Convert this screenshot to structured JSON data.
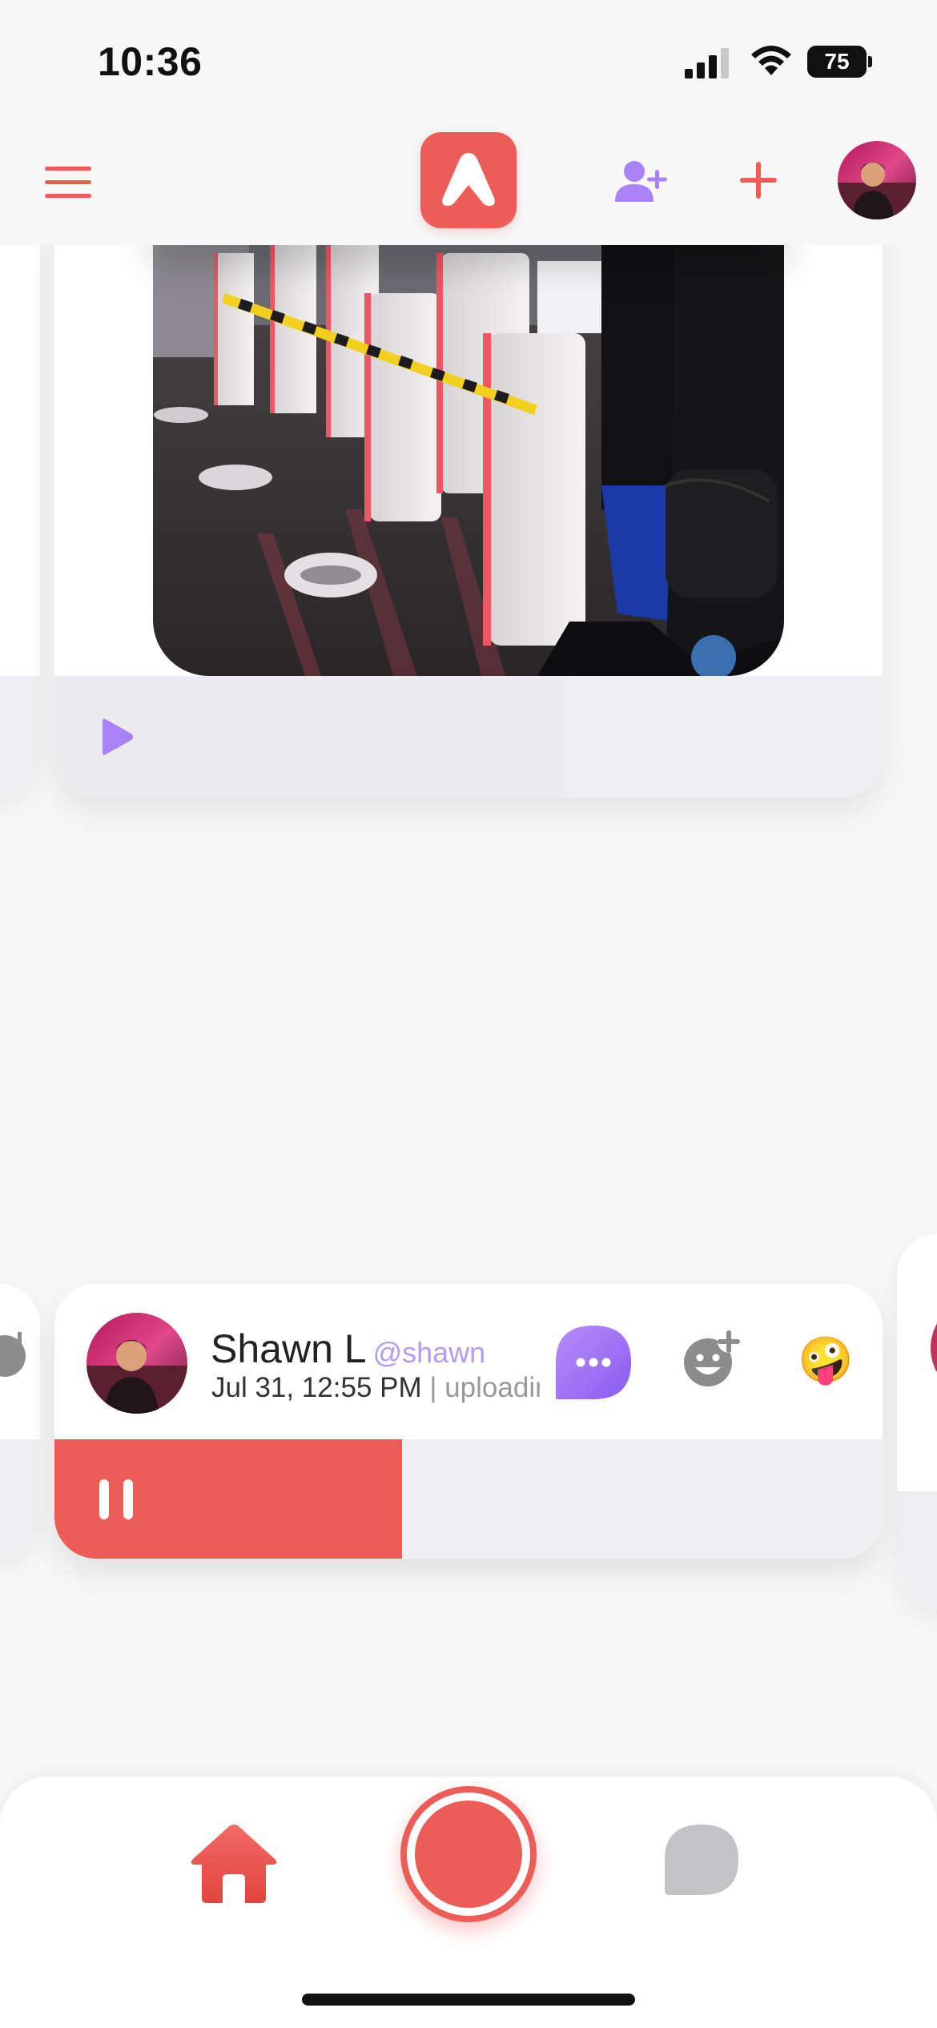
{
  "status_bar": {
    "time": "10:36",
    "battery_level": "75",
    "icons": [
      "signal-icon",
      "wifi-icon",
      "battery-icon"
    ]
  },
  "header": {
    "icons": [
      "menu-icon",
      "app-logo",
      "add-user-icon",
      "plus-icon",
      "avatar"
    ]
  },
  "feed": {
    "top_card": {
      "image": "photo of airport e-gates with yellow-black barrier and people standing",
      "player_icon": "play-icon"
    },
    "bottom_card": {
      "author_name": "Shawn L",
      "author_handle": "@shawn",
      "timestamp": "Jul 31, 12:55 PM",
      "separator": "|",
      "status": "uploading",
      "emoji": "🤪",
      "player_icon": "pause-icon",
      "progress": 0.42
    }
  },
  "tab_bar": {
    "icons": [
      "home-icon",
      "record-button",
      "chat-icon"
    ]
  },
  "colors": {
    "accent": "#ec5d57",
    "purple": "#a982f5",
    "handle": "#b59bf2",
    "background": "#f7f7f8",
    "bar": "#efeff3"
  }
}
